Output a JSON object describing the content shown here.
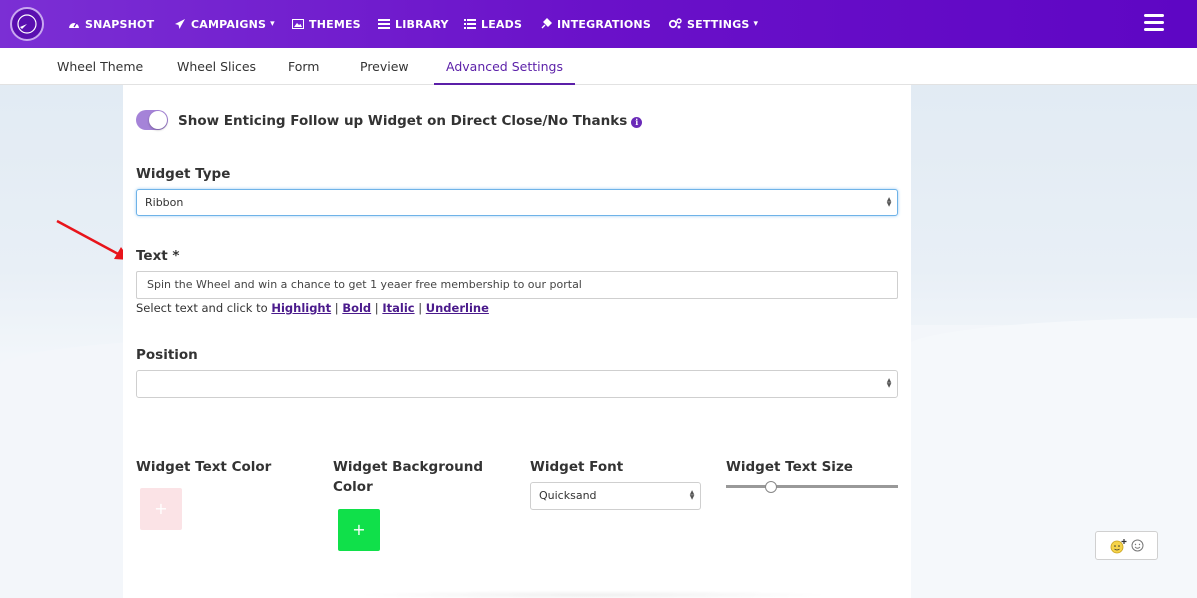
{
  "nav": {
    "items": [
      {
        "label": "SNAPSHOT",
        "icon": "dashboard-icon"
      },
      {
        "label": "CAMPAIGNS",
        "icon": "paper-plane-icon",
        "dropdown": true
      },
      {
        "label": "THEMES",
        "icon": "image-icon"
      },
      {
        "label": "LIBRARY",
        "icon": "list-icon"
      },
      {
        "label": "LEADS",
        "icon": "list-ul-icon"
      },
      {
        "label": "INTEGRATIONS",
        "icon": "plug-icon"
      },
      {
        "label": "SETTINGS",
        "icon": "gears-icon",
        "dropdown": true
      }
    ],
    "caret": "▾"
  },
  "tabs": [
    {
      "label": "Wheel Theme"
    },
    {
      "label": "Wheel Slices"
    },
    {
      "label": "Form"
    },
    {
      "label": "Preview"
    },
    {
      "label": "Advanced Settings",
      "active": true
    }
  ],
  "form": {
    "toggle_label": "Show Enticing Follow up Widget on Direct Close/No Thanks",
    "toggle_on": true,
    "info": "i",
    "widget_type_label": "Widget Type",
    "widget_type_value": "Ribbon",
    "text_label": "Text *",
    "text_value": "Spin the Wheel and win a chance to get 1 yeaer free membership to our portal",
    "helper_prefix": "Select text and click to ",
    "helper_links": [
      "Highlight",
      "Bold",
      "Italic",
      "Underline"
    ],
    "helper_sep": " | ",
    "position_label": "Position",
    "position_value": "",
    "text_color_label": "Widget Text Color",
    "bg_color_label": "Widget Background",
    "bg_color_label2": "Color",
    "font_label": "Widget Font",
    "font_value": "Quicksand",
    "size_label": "Widget Text Size",
    "add_symbol": "+",
    "text_color": "#fbe3e6",
    "bg_color": "#10e04a",
    "text_size_level": 0.27
  },
  "colors": {
    "brand": "#6a11c9",
    "accent": "#5b1fa8"
  }
}
